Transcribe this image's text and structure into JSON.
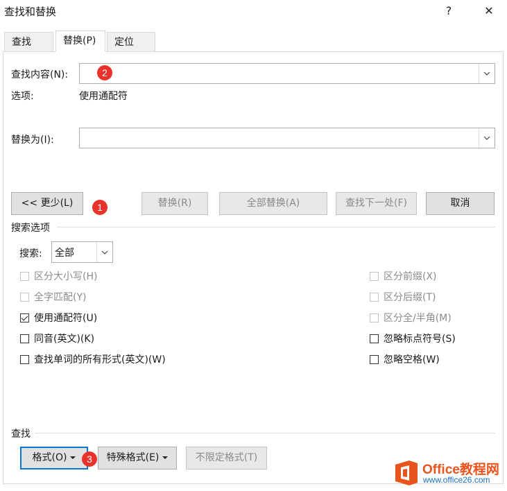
{
  "window": {
    "title": "查找和替换",
    "help_label": "?",
    "close_label": "✕"
  },
  "tabs": [
    {
      "label": "查找(D)",
      "active": false
    },
    {
      "label": "替换(P)",
      "active": true
    },
    {
      "label": "定位(G)",
      "active": false
    }
  ],
  "find": {
    "label": "查找内容(N):",
    "value": "",
    "options_label": "选项:",
    "options_value": "使用通配符"
  },
  "replace": {
    "label": "替换为(I):",
    "value": ""
  },
  "buttons": {
    "less": "<< 更少(L)",
    "replace": "替换(R)",
    "replace_all": "全部替换(A)",
    "find_next": "查找下一处(F)",
    "cancel": "取消"
  },
  "search_options": {
    "section_title": "搜索选项",
    "search_label": "搜索:",
    "search_value": "全部",
    "left": [
      {
        "label": "区分大小写(H)",
        "checked": false,
        "disabled": true
      },
      {
        "label": "全字匹配(Y)",
        "checked": false,
        "disabled": true
      },
      {
        "label": "使用通配符(U)",
        "checked": true,
        "disabled": false
      },
      {
        "label": "同音(英文)(K)",
        "checked": false,
        "disabled": false
      },
      {
        "label": "查找单词的所有形式(英文)(W)",
        "checked": false,
        "disabled": false
      }
    ],
    "right": [
      {
        "label": "区分前缀(X)",
        "checked": false,
        "disabled": true
      },
      {
        "label": "区分后缀(T)",
        "checked": false,
        "disabled": true
      },
      {
        "label": "区分全/半角(M)",
        "checked": false,
        "disabled": true
      },
      {
        "label": "忽略标点符号(S)",
        "checked": false,
        "disabled": false
      },
      {
        "label": "忽略空格(W)",
        "checked": false,
        "disabled": false
      }
    ]
  },
  "find_section": {
    "title": "查找",
    "format": "格式(O)",
    "special": "特殊格式(E)",
    "no_format": "不限定格式(T)"
  },
  "annotations": [
    "1",
    "2",
    "3"
  ],
  "watermark": {
    "brand": "Office教程网",
    "url": "www.office26.com",
    "brand_color": "#e8541c",
    "url_color": "#1a6fc0"
  },
  "colors": {
    "accent": "#0078d7",
    "badge": "#e8322b"
  }
}
